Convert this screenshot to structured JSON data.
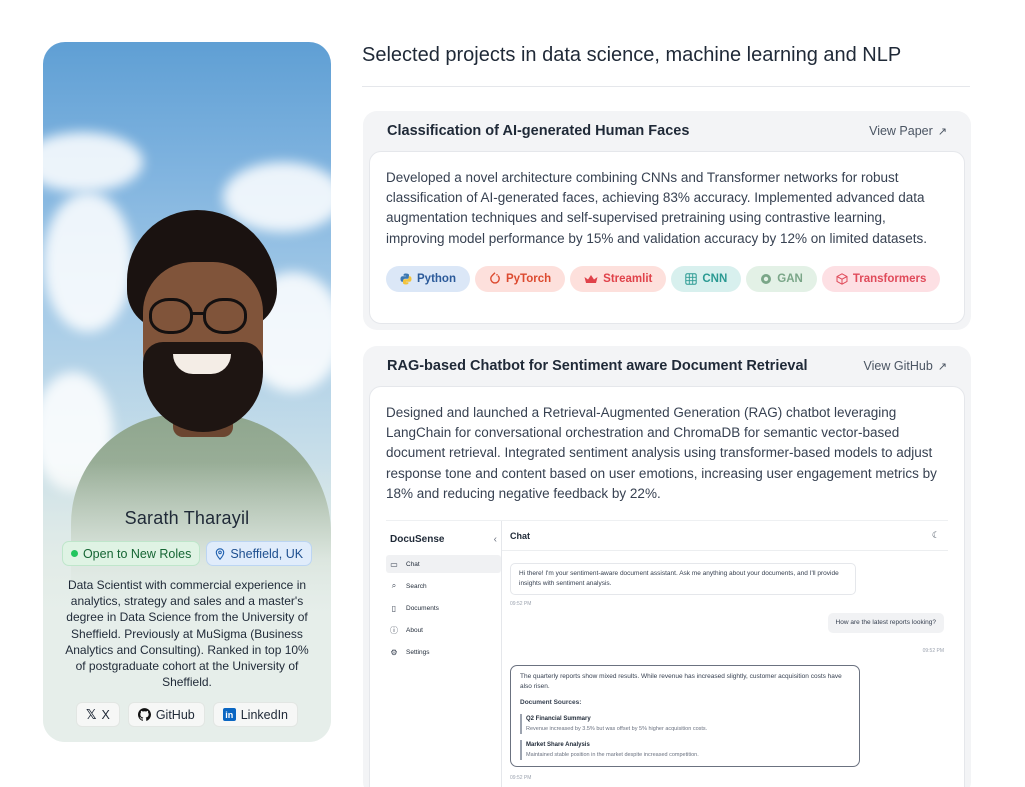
{
  "profile": {
    "name": "Sarath Tharayil",
    "status_badge": "Open to New Roles",
    "location_badge": "Sheffield, UK",
    "bio": "Data Scientist with commercial experience in analytics, strategy and sales and a master's degree in Data Science from the University of Sheffield. Previously at MuSigma (Business Analytics and Consulting). Ranked in top 10% of postgraduate cohort at the University of Sheffield.",
    "socials": [
      {
        "label": "X",
        "icon": "x-icon"
      },
      {
        "label": "GitHub",
        "icon": "github-icon"
      },
      {
        "label": "LinkedIn",
        "icon": "linkedin-icon"
      }
    ]
  },
  "section": {
    "title": "Selected projects in data science, machine learning and NLP"
  },
  "projects": [
    {
      "title": "Classification of AI-generated Human Faces",
      "link_label": "View Paper",
      "description": "Developed a novel architecture combining CNNs and Transformer networks for robust classification of AI-generated faces, achieving 83% accuracy. Implemented advanced data augmentation techniques and self-supervised pretraining using contrastive learning, improving model performance by 15% and validation accuracy by 12% on limited datasets.",
      "tags": [
        "Python",
        "PyTorch",
        "Streamlit",
        "CNN",
        "GAN",
        "Transformers"
      ]
    },
    {
      "title": "RAG-based Chatbot for Sentiment aware Document Retrieval",
      "link_label": "View GitHub",
      "description": "Designed and launched a Retrieval-Augmented Generation (RAG) chatbot leveraging LangChain for conversational orchestration and ChromaDB for semantic vector-based document retrieval. Integrated sentiment analysis using transformer-based models to adjust response tone and content based on user emotions, increasing user engagement metrics by 18% and reducing negative feedback by 22%."
    }
  ],
  "app_screenshot": {
    "brand": "DocuSense",
    "collapse_glyph": "‹",
    "nav": [
      "Chat",
      "Search",
      "Documents",
      "About",
      "Settings"
    ],
    "header": "Chat",
    "bot_greeting": "Hi there! I'm your sentiment-aware document assistant. Ask me anything about your documents, and I'll provide insights with sentiment analysis.",
    "time1": "09:52 PM",
    "user_question": "How are the latest reports looking?",
    "time2": "09:52 PM",
    "bot_answer": "The quarterly reports show mixed results. While revenue has increased slightly, customer acquisition costs have also risen.",
    "sources_title": "Document Sources:",
    "sources": [
      {
        "title": "Q2 Financial Summary",
        "text": "Revenue increased by 3.5% but was offset by 5% higher acquisition costs."
      },
      {
        "title": "Market Share Analysis",
        "text": "Maintained stable position in the market despite increased competition."
      }
    ],
    "time3": "09:52 PM"
  }
}
